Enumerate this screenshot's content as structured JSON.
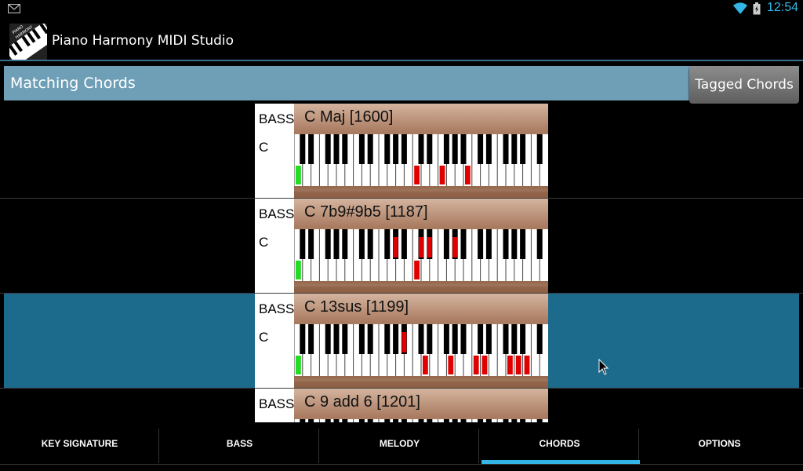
{
  "status": {
    "time": "12:54",
    "icons": [
      "gmail-icon",
      "wifi-icon",
      "battery-charging-icon"
    ],
    "accent": "#33b5e5"
  },
  "app": {
    "title": "Piano Harmony MIDI Studio",
    "logo_text": "PIANO HARMONY"
  },
  "header": {
    "title": "Matching Chords",
    "tagged_button": "Tagged Chords"
  },
  "chords": [
    {
      "bass_label": "BASS",
      "bass_note": "C",
      "name": "C Maj [1600]",
      "green_keys": [
        "C"
      ],
      "red_white": [
        14,
        17,
        20
      ],
      "red_black": [],
      "selected": false
    },
    {
      "bass_label": "BASS",
      "bass_note": "C",
      "name": "C 7b9#9b5 [1187]",
      "green_keys": [
        "C"
      ],
      "red_white": [
        14,
        30
      ],
      "red_black": [
        8,
        10,
        11,
        13
      ],
      "selected": false
    },
    {
      "bass_label": "BASS",
      "bass_note": "C",
      "name": "C 13sus [1199]",
      "green_keys": [
        "C"
      ],
      "red_white": [
        15,
        18,
        21,
        22,
        25,
        26,
        27,
        30
      ],
      "red_black": [
        9
      ],
      "selected": true
    },
    {
      "bass_label": "BASS",
      "bass_note": "C",
      "name": "C 9 add 6 [1201]",
      "green_keys": [
        "C"
      ],
      "red_white": [],
      "red_black": [],
      "selected": false
    }
  ],
  "tabs": [
    {
      "label": "KEY SIGNATURE",
      "active": false
    },
    {
      "label": "BASS",
      "active": false
    },
    {
      "label": "MELODY",
      "active": false
    },
    {
      "label": "CHORDS",
      "active": true
    },
    {
      "label": "OPTIONS",
      "active": false
    }
  ]
}
